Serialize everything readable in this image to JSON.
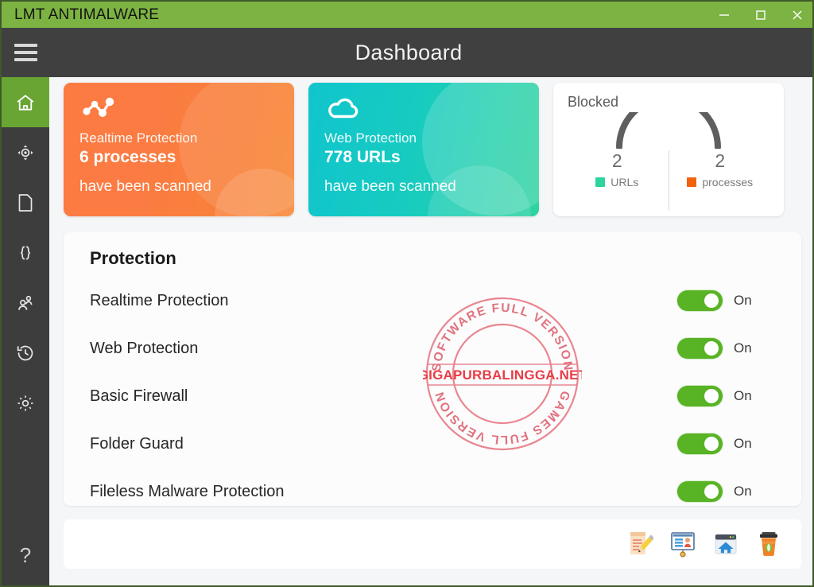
{
  "window": {
    "app_title": "LMT ANTIMALWARE",
    "titlebar_color": "#7cb342",
    "controls": {
      "minimize": "minimize-button",
      "maximize": "maximize-button",
      "close": "close-button"
    }
  },
  "header": {
    "page_title": "Dashboard",
    "menu_icon": "hamburger-menu-icon"
  },
  "sidebar": {
    "items": [
      {
        "icon": "home-icon",
        "name": "sidebar-item-home",
        "active": true
      },
      {
        "icon": "scan-target-icon",
        "name": "sidebar-item-scan",
        "active": false
      },
      {
        "icon": "document-icon",
        "name": "sidebar-item-reports",
        "active": false
      },
      {
        "icon": "braces-icon",
        "name": "sidebar-item-rules",
        "active": false
      },
      {
        "icon": "users-icon",
        "name": "sidebar-item-users",
        "active": false
      },
      {
        "icon": "history-clock-icon",
        "name": "sidebar-item-history",
        "active": false
      },
      {
        "icon": "gear-icon",
        "name": "sidebar-item-settings",
        "active": false
      }
    ],
    "help_label": "?"
  },
  "cards": {
    "realtime": {
      "icon": "network-nodes-icon",
      "line1": "Realtime Protection",
      "line2": "6 processes",
      "line3": "have been scanned",
      "color": "#fb7b43"
    },
    "web": {
      "icon": "cloud-icon",
      "line1": "Web Protection",
      "line2": "778 URLs",
      "line3": "have been scanned",
      "color": "#17cbc0"
    },
    "blocked": {
      "title": "Blocked",
      "gauge_color": "#5f5f5f",
      "stats": [
        {
          "count": "2",
          "label": "URLs",
          "color": "#2ed39f"
        },
        {
          "count": "2",
          "label": "processes",
          "color": "#f1620c"
        }
      ]
    }
  },
  "protection": {
    "heading": "Protection",
    "rows": [
      {
        "label": "Realtime Protection",
        "state": "On",
        "on": true
      },
      {
        "label": "Web Protection",
        "state": "On",
        "on": true
      },
      {
        "label": "Basic Firewall",
        "state": "On",
        "on": true
      },
      {
        "label": "Folder Guard",
        "state": "On",
        "on": true
      },
      {
        "label": "Fileless Malware Protection",
        "state": "On",
        "on": true
      }
    ],
    "toggle_on_color": "#58b325"
  },
  "watermark": {
    "top_arc": "SOFTWARE FULL VERSION",
    "center": "GIGAPURBALINGGA.NET",
    "bottom_arc": "GAMES FULL VERSION",
    "color": "#e8808a"
  },
  "bottom_bar": {
    "tray_icons": [
      {
        "name": "notepad-pencil-icon"
      },
      {
        "name": "id-card-window-icon"
      },
      {
        "name": "browser-home-icon"
      },
      {
        "name": "coffee-cup-icon"
      }
    ]
  }
}
